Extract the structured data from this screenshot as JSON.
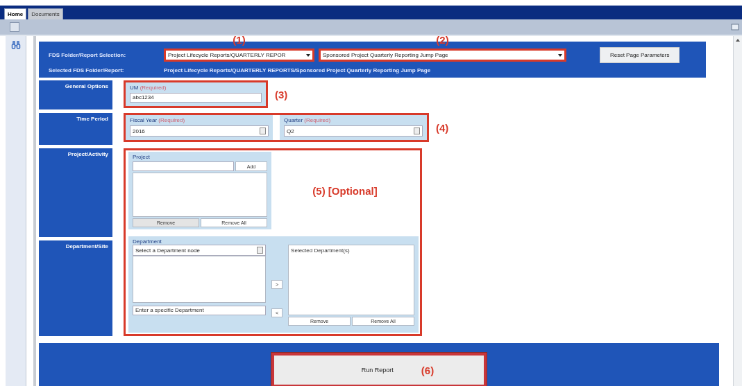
{
  "tabs": [
    {
      "label": "Home",
      "selected": true
    },
    {
      "label": "Documents",
      "selected": false
    }
  ],
  "header": {
    "folder_label": "FDS Folder/Report Selection:",
    "folder_select": "Project Lifecycle Reports/QUARTERLY REPOR",
    "folder_annotation": "(1)",
    "report_select": "Sponsored Project Quarterly Reporting Jump Page",
    "report_annotation": "(2)",
    "selected_label": "Selected FDS Folder/Report:",
    "selected_value": "Project Lifecycle Reports/QUARTERLY REPORTS/Sponsored Project Quarterly Reporting Jump Page",
    "reset_button": "Reset Page Parameters"
  },
  "general_options": {
    "heading": "General Options",
    "field_label": "UM",
    "required": "(Required)",
    "value": "abc1234",
    "annotation": "(3)"
  },
  "time_period": {
    "heading": "Time Period",
    "annotation": "(4)",
    "fields": [
      {
        "label": "Fiscal Year",
        "required": "(Required)",
        "value": "2016"
      },
      {
        "label": "Quarter",
        "required": "(Required)",
        "value": "Q2"
      }
    ]
  },
  "project_activity": {
    "heading": "Project/Activity",
    "panel_title": "Project",
    "add_button": "Add",
    "buttons": [
      "Remove",
      "Remove All"
    ]
  },
  "optional_annotation": "(5) [Optional]",
  "department_site": {
    "heading": "Department/Site",
    "panel_title": "Department",
    "select": "Select a Department node",
    "search_placeholder": "Enter a specific Department",
    "move_buttons": [
      ">",
      "<"
    ],
    "selected_title": "Selected Department(s)",
    "buttons": [
      "Remove",
      "Remove All"
    ]
  },
  "run_button": "Run Report",
  "run_annotation": "(6)"
}
